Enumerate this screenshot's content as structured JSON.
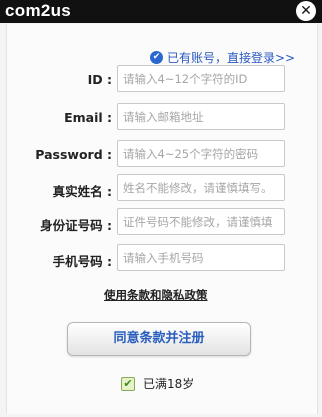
{
  "header": {
    "brand": "com2us",
    "close_icon": "close-icon"
  },
  "login_link": {
    "icon": "check-circle-icon",
    "label": "已有账号，直接登录>>"
  },
  "form": {
    "fields": [
      {
        "label": "ID :",
        "placeholder": "请输入4~12个字符的ID",
        "value": ""
      },
      {
        "label": "Email :",
        "placeholder": "请输入邮箱地址",
        "value": ""
      },
      {
        "label": "Password :",
        "placeholder": "请输入4~25个字符的密码",
        "value": ""
      },
      {
        "label": "真实姓名 :",
        "placeholder": "姓名不能修改，请谨慎填写。",
        "value": ""
      },
      {
        "label": "身份证号码 :",
        "placeholder": "证件号码不能修改，请谨慎填",
        "value": ""
      },
      {
        "label": "手机号码 :",
        "placeholder": "请输入手机号码",
        "value": ""
      }
    ]
  },
  "policy_link": "使用条款和隐私政策",
  "agree_button": "同意条款并注册",
  "age_check": {
    "checked": true,
    "label": "已满18岁"
  }
}
